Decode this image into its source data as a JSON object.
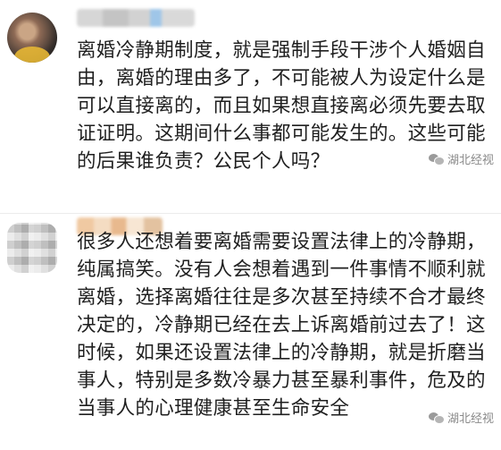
{
  "comments": [
    {
      "text": "离婚冷静期制度，就是强制手段干涉个人婚姻自\n由，离婚的理由多了，不可能被人为设定什么是\n可以直接离的，而且如果想直接离必须先要去取\n证证明。这期间什么事都可能发生的。这些可能\n的后果谁负责？公民个人吗？",
      "watermark": "湖北经视"
    },
    {
      "text": "很多人还想着要离婚需要设置法律上的冷静期，\n纯属搞笑。没有人会想着遇到一件事情不顺利就\n离婚，选择离婚往往是多次甚至持续不合才最终\n决定的，冷静期已经在去上诉离婚前过去了！这\n时候，如果还设置法律上的冷静期，就是折磨当\n事人，特别是多数冷暴力甚至暴利事件，危及的\n当事人的心理健康甚至生命安全",
      "watermark": "湖北经视"
    }
  ],
  "icons": {
    "avatar": "avatar-icon",
    "watermark": "wechat-icon"
  }
}
